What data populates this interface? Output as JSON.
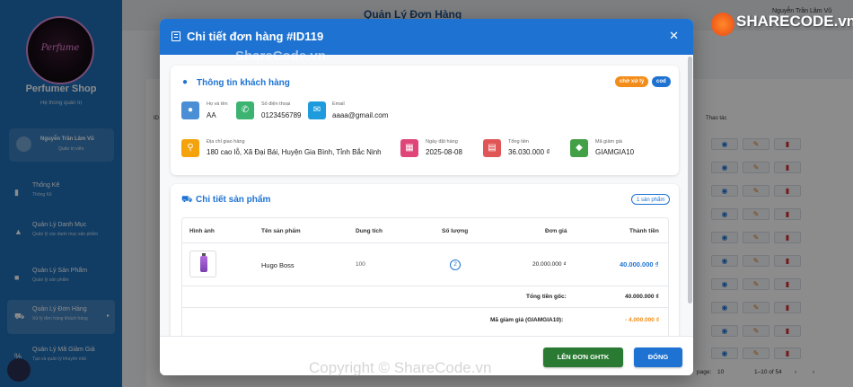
{
  "sidebar": {
    "logo_text": "Perfume",
    "shop_name": "Perfumer Shop",
    "shop_subtitle": "Hệ thống quản trị",
    "user_name": "Nguyễn Trần Lâm Vũ",
    "user_role": "Quản trị viên",
    "items": [
      {
        "label": "Thống Kê",
        "sub": "Thống Kê",
        "icon": "bar-chart-icon"
      },
      {
        "label": "Quản Lý Danh Mục",
        "sub": "Quản lý các danh mục sản phẩm",
        "icon": "category-icon"
      },
      {
        "label": "Quản Lý Sản Phẩm",
        "sub": "Quản lý sản phẩm",
        "icon": "inventory-icon"
      },
      {
        "label": "Quản Lý Đơn Hàng",
        "sub": "Xử lý đơn hàng khách hàng",
        "icon": "cart-icon"
      },
      {
        "label": "Quản Lý Mã Giảm Giá",
        "sub": "Tạo và quản lý khuyến mãi",
        "icon": "discount-icon"
      }
    ]
  },
  "background": {
    "title": "Quản Lý Đơn Hàng",
    "user": "Nguyễn Trần Lâm Vũ",
    "col_id": "ID",
    "col_action": "Thao tác",
    "pager_label": "page:",
    "pager_size": "10",
    "pager_range": "1–10 of 54"
  },
  "modal": {
    "title": "Chi tiết đơn hàng #ID119",
    "customer": {
      "title": "Thông tin khách hàng",
      "status_badge": "chờ xử lý",
      "payment_badge": "cod",
      "name_label": "Họ và tên",
      "name": "AA",
      "phone_label": "Số điện thoại",
      "phone": "0123456789",
      "email_label": "Email",
      "email": "aaaa@gmail.com",
      "address_label": "Địa chỉ giao hàng",
      "address": "180 cao lỗ, Xã Đại Bái, Huyện Gia Bình, Tỉnh Bắc Ninh",
      "date_label": "Ngày đặt hàng",
      "date": "2025-08-08",
      "total_label": "Tổng tiền",
      "total": "36.030.000 ₫",
      "coupon_label": "Mã giảm giá",
      "coupon": "GIAMGIA10"
    },
    "products": {
      "title": "Chi tiết sản phẩm",
      "count_badge": "1 sản phẩm",
      "headers": {
        "image": "Hình ảnh",
        "name": "Tên sản phẩm",
        "volume": "Dung tích",
        "quantity": "Số lượng",
        "price": "Đơn giá",
        "subtotal": "Thành tiền"
      },
      "rows": [
        {
          "name": "Hugo Boss",
          "volume": "100",
          "quantity": "2",
          "price": "20.000.000 ₫",
          "subtotal": "40.000.000 ₫"
        }
      ],
      "original_total_label": "Tổng tiền gốc:",
      "original_total": "40.000.000 ₫",
      "discount_label": "Mã giảm giá (GIAMGIA10):",
      "discount": "- 4.000.000 ₫"
    },
    "buttons": {
      "ghtk": "LÊN ĐƠN GHTK",
      "close": "ĐÓNG"
    }
  },
  "watermarks": {
    "brand": "SHARECODE.vn",
    "top": "ShareCode.vn",
    "bottom": "Copyright © ShareCode.vn"
  },
  "colors": {
    "primary": "#1e73d2",
    "sidebar": "#1f6fb8",
    "green": "#2a7a33",
    "orange": "#f28c1a"
  }
}
